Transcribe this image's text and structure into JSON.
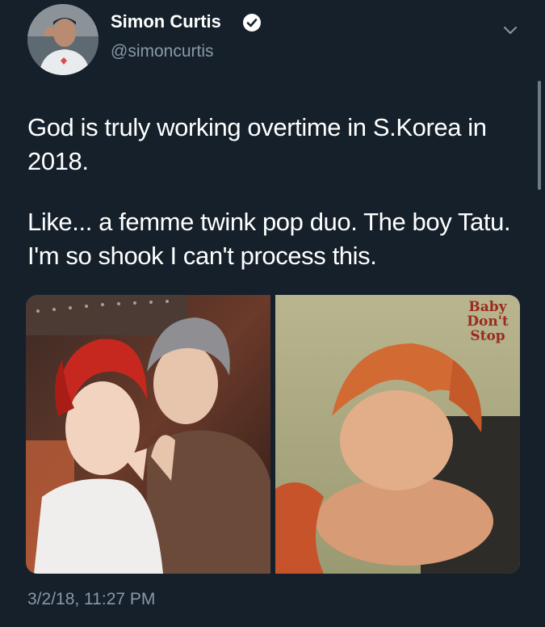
{
  "tweet": {
    "author": {
      "display_name": "Simon Curtis",
      "handle": "@simoncurtis",
      "verified": true
    },
    "text_paragraphs": [
      "God is truly working overtime in S.Korea in 2018.",
      "Like... a femme twink pop duo. The boy Tatu. I'm so shook I can't process this."
    ],
    "media": {
      "right_image_text": [
        "Baby",
        "Don't",
        "Stop"
      ]
    },
    "timestamp": "3/2/18, 11:27 PM"
  },
  "icons": {
    "verified": "verified-badge-icon",
    "menu": "chevron-down-icon"
  },
  "colors": {
    "background": "#15202b",
    "primary_text": "#ffffff",
    "secondary_text": "#8899a6",
    "accent": "#1da1f2"
  }
}
